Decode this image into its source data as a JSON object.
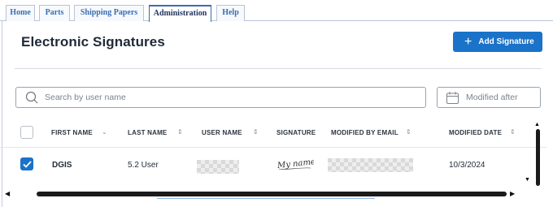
{
  "tabs": [
    {
      "label": "Home",
      "active": false
    },
    {
      "label": "Parts",
      "active": false
    },
    {
      "label": "Shipping Papers",
      "active": false
    },
    {
      "label": "Administration",
      "active": true
    },
    {
      "label": "Help",
      "active": false
    }
  ],
  "header": {
    "title": "Electronic Signatures",
    "add_button_label": "Add Signature"
  },
  "filters": {
    "search_placeholder": "Search by user name",
    "search_value": "",
    "date_placeholder": "Modified after",
    "date_value": ""
  },
  "table": {
    "columns": [
      "FIRST NAME",
      "LAST NAME",
      "USER NAME",
      "SIGNATURE",
      "MODIFIED BY EMAIL",
      "MODIFIED DATE"
    ],
    "rows": [
      {
        "selected": true,
        "first_name": "DGIS",
        "last_name": "5.2 User",
        "user_name_redacted": true,
        "signature_image": "My name",
        "modified_by_email_redacted": true,
        "modified_date": "10/3/2024"
      }
    ]
  },
  "colors": {
    "accent": "#1a73c8",
    "tab_text": "#3a6db5",
    "active_tab_text": "#23335e",
    "header_text": "#1f2a37"
  },
  "icons": {
    "search": "search-icon",
    "calendar": "calendar-icon",
    "plus": "plus-icon",
    "check": "check-icon",
    "sort": "sort-icon"
  }
}
